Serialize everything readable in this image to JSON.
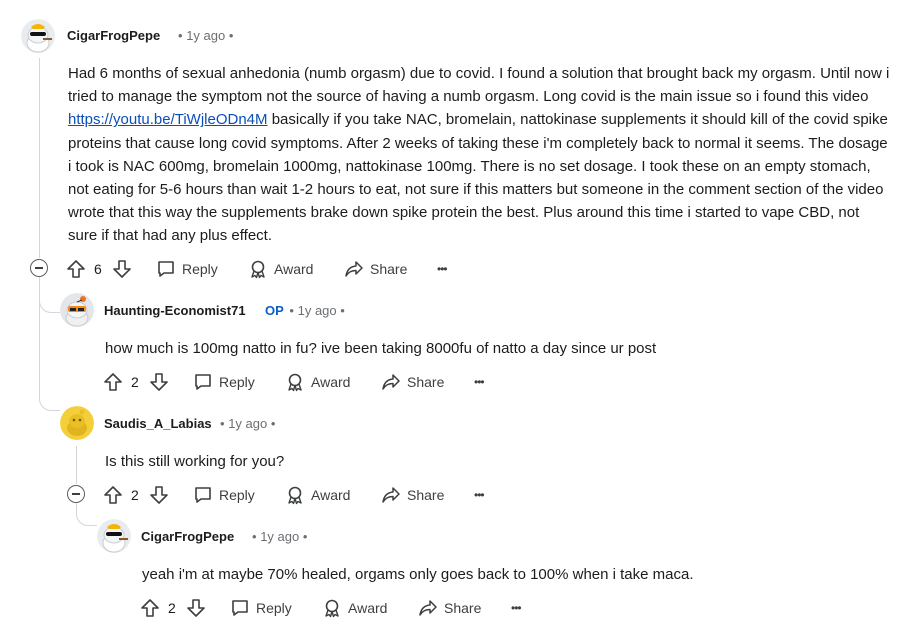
{
  "comments": [
    {
      "username": "CigarFrogPepe",
      "op": "",
      "time": "1y ago",
      "text_before_link": "Had 6 months of sexual anhedonia (numb orgasm) due to covid. I found a solution that brought back my orgasm. Until now i tried to manage the symptom not the source of having a numb orgasm. Long covid is the main issue so i found this video ",
      "link": "https://youtu.be/TiWjleODn4M",
      "text_after_link": " basically if you take NAC, bromelain, nattokinase supplements it should kill of the covid spike proteins that cause long covid symptoms. After 2 weeks of taking these i'm completely back to normal it seems. The dosage i took is NAC 600mg, bromelain 1000mg, nattokinase 100mg. There is no set dosage. I took these on an empty stomach, not eating for 5-6 hours than wait 1-2 hours to eat, not sure if this matters but someone in the comment section of the video wrote that this way the supplements brake down spike protein the best. Plus around this time i started to vape CBD, not sure if that had any plus effect.",
      "votes": "6"
    },
    {
      "username": "Haunting-Economist71",
      "op": "OP",
      "time": "1y ago",
      "text": "how much is 100mg natto in fu? ive been taking 8000fu of natto a day since ur post",
      "votes": "2"
    },
    {
      "username": "Saudis_A_Labias",
      "op": "",
      "time": "1y ago",
      "text": "Is this still working for you?",
      "votes": "2"
    },
    {
      "username": "CigarFrogPepe",
      "op": "",
      "time": "1y ago",
      "text": "yeah i'm at maybe 70% healed, orgams only goes back to 100% when i take maca.",
      "votes": "2"
    }
  ],
  "actions": {
    "reply": "Reply",
    "award": "Award",
    "share": "Share",
    "more": "•••"
  },
  "separator": "•",
  "colors": {
    "link": "#0a4fb8",
    "op": "#0a5fc2",
    "thread_line": "#d3d6da",
    "text": "#1c1c1c",
    "meta": "#6b6f73"
  }
}
